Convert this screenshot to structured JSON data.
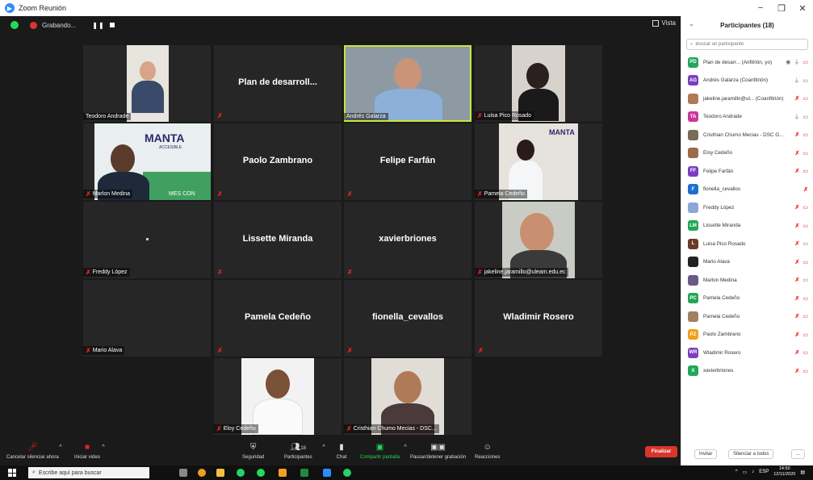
{
  "window": {
    "title": "Zoom Reunión",
    "controls": [
      "−",
      "❐",
      "✕"
    ]
  },
  "topbar": {
    "recording_label": "Grabando...",
    "view_label": "Vista"
  },
  "tiles": [
    {
      "name": "Teodoro Andrade",
      "kind": "video"
    },
    {
      "name": "Plan de desarroll...",
      "kind": "name"
    },
    {
      "name": "Andrés Galarza",
      "kind": "video",
      "active": true
    },
    {
      "name": "Luisa Pico Rosado",
      "kind": "video"
    },
    {
      "name": "Marlon Medina",
      "kind": "video"
    },
    {
      "name": "Paolo Zambrano",
      "kind": "name"
    },
    {
      "name": "Felipe Farfán",
      "kind": "name"
    },
    {
      "name": "Pamela Cedeño",
      "kind": "video"
    },
    {
      "name": "Freddy López",
      "kind": "blank"
    },
    {
      "name": "Lissette Miranda",
      "kind": "name"
    },
    {
      "name": "xavierbriones",
      "kind": "name"
    },
    {
      "name": "jakeline.jaramillo@uleam.edu.ec",
      "kind": "video"
    },
    {
      "name": "Mario Alava",
      "kind": "blank"
    },
    {
      "name": "Pamela Cedeño",
      "kind": "name"
    },
    {
      "name": "fionella_cevallos",
      "kind": "name"
    },
    {
      "name": "Wladimir Rosero",
      "kind": "name"
    },
    {
      "name": "Eloy Cedeño",
      "kind": "video"
    },
    {
      "name": "Cristhian Chumo Mecias - DSC...",
      "kind": "video"
    }
  ],
  "logo_text": "MANTA",
  "logo_sub": "ACCESIBLE",
  "logo_strip": "MES CON",
  "toolbar": {
    "mute": "Cancelar silenciar ahora",
    "video": "Iniciar video",
    "security": "Seguridad",
    "participants": "Participantes",
    "participants_count": "18",
    "chat": "Chat",
    "share": "Compartir pantalla",
    "record": "Pausar/detener grabación",
    "reactions": "Reacciones",
    "end": "Finalizar"
  },
  "panel": {
    "title": "Participantes (18)",
    "search_placeholder": "Buscar un participante",
    "invite": "Invitar",
    "mute_all": "Silenciar a todos",
    "more": "..."
  },
  "participants": [
    {
      "initials": "PD",
      "name": "Plan de desarr... (Anfitrión, yo)",
      "color": "#23a55a",
      "mic": "on-rec",
      "cam": "off"
    },
    {
      "initials": "AG",
      "name": "Andrés Galarza (Coanfitrión)",
      "color": "#7b3fbf",
      "mic": "on",
      "cam": "on"
    },
    {
      "initials": "",
      "name": "jakeline.jaramillo@ul... (Coanfitrión)",
      "color": "#b07a58",
      "mic": "off",
      "cam": "off"
    },
    {
      "initials": "TA",
      "name": "Teodoro Andrade",
      "color": "#c8379a",
      "mic": "on",
      "cam": "on"
    },
    {
      "initials": "",
      "name": "Cristhian Chumo Mecias - DSC G...",
      "color": "#7a6a5a",
      "mic": "off",
      "cam": "off"
    },
    {
      "initials": "",
      "name": "Eloy Cedeño",
      "color": "#9b6b4a",
      "mic": "off",
      "cam": "off"
    },
    {
      "initials": "FF",
      "name": "Felipe Farfán",
      "color": "#7b3fbf",
      "mic": "off",
      "cam": "off"
    },
    {
      "initials": "F",
      "name": "fionella_cevallos",
      "color": "#1e6fd0",
      "mic": "off",
      "cam": "none"
    },
    {
      "initials": "",
      "name": "Freddy López",
      "color": "#8aa8d6",
      "mic": "off",
      "cam": "off"
    },
    {
      "initials": "LM",
      "name": "Lissette Miranda",
      "color": "#23a55a",
      "mic": "off",
      "cam": "off"
    },
    {
      "initials": "L",
      "name": "Luisa Pico Rosado",
      "color": "#6b3a2a",
      "mic": "off",
      "cam": "on"
    },
    {
      "initials": "",
      "name": "Mario Alava",
      "color": "#222222",
      "mic": "off",
      "cam": "off"
    },
    {
      "initials": "",
      "name": "Marlon Medina",
      "color": "#6a5a8a",
      "mic": "off",
      "cam": "on"
    },
    {
      "initials": "PC",
      "name": "Pamela Cedeño",
      "color": "#23a55a",
      "mic": "off",
      "cam": "off"
    },
    {
      "initials": "",
      "name": "Pamela Cedeño",
      "color": "#a08060",
      "mic": "off",
      "cam": "off"
    },
    {
      "initials": "PZ",
      "name": "Paolo Zambrano",
      "color": "#f0a020",
      "mic": "off",
      "cam": "off"
    },
    {
      "initials": "WR",
      "name": "Wladimir Rosero",
      "color": "#7b3fbf",
      "mic": "off",
      "cam": "off"
    },
    {
      "initials": "X",
      "name": "xavierbriones",
      "color": "#23a55a",
      "mic": "off",
      "cam": "off"
    }
  ],
  "taskbar": {
    "search_placeholder": "Escribe aquí para buscar",
    "lang": "ESP",
    "time": "14:50",
    "date": "12/11/2020"
  },
  "colors": {
    "accent": "#2d8cff",
    "active_speaker": "#c8e63c",
    "end_button": "#d9352b",
    "muted": "#e22222"
  }
}
